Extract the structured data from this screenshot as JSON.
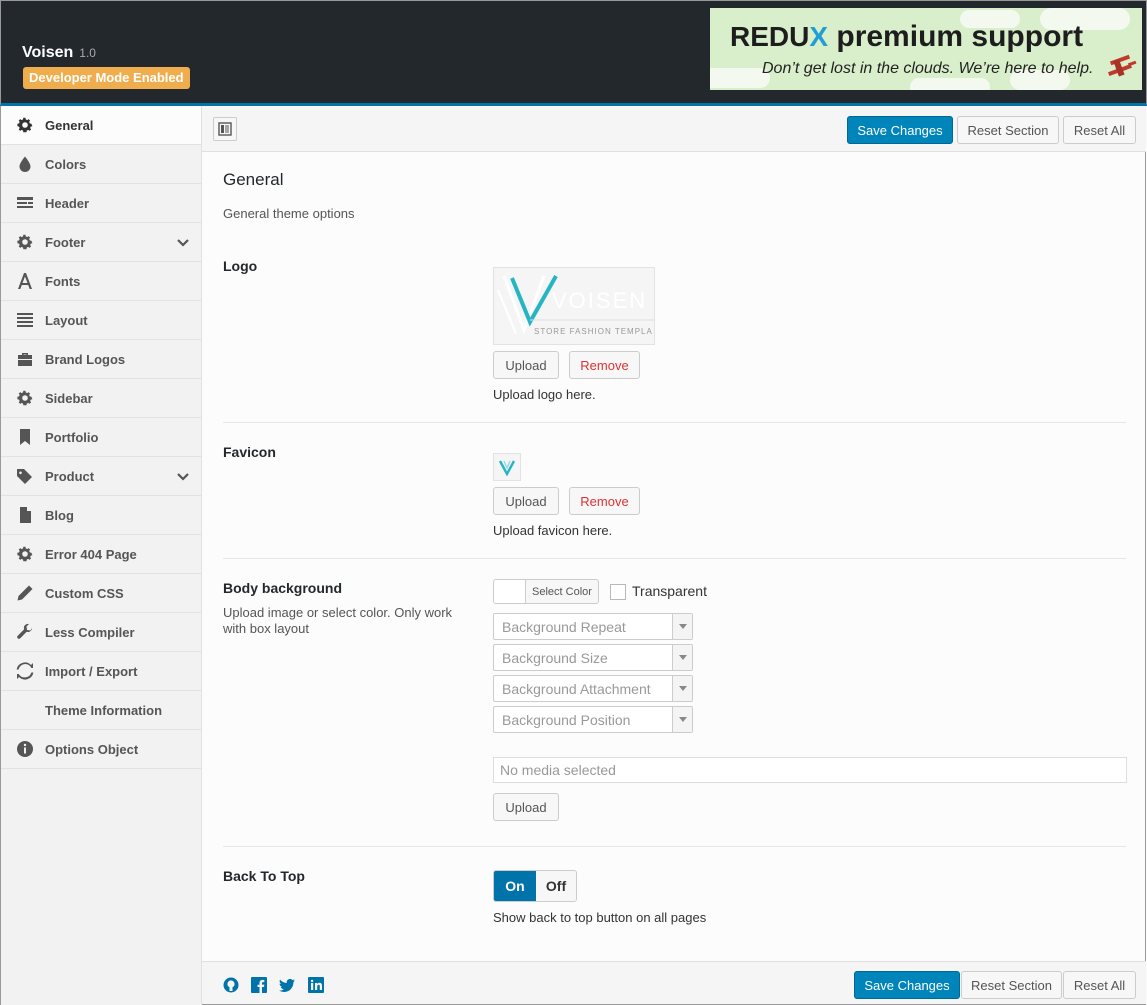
{
  "header": {
    "app_name": "Voisen",
    "version": "1.0",
    "dev_badge": "Developer Mode Enabled",
    "promo": {
      "brand": "REDU",
      "brand_x": "X",
      "headline": "premium support",
      "tagline": "Don’t get lost in the clouds. We’re here to help."
    }
  },
  "sidebar": {
    "items": [
      {
        "label": "General",
        "icon": "gear-icon"
      },
      {
        "label": "Colors",
        "icon": "drop-icon"
      },
      {
        "label": "Header",
        "icon": "header-icon"
      },
      {
        "label": "Footer",
        "icon": "gear-icon"
      },
      {
        "label": "Fonts",
        "icon": "font-icon"
      },
      {
        "label": "Layout",
        "icon": "layout-icon"
      },
      {
        "label": "Brand Logos",
        "icon": "briefcase-icon"
      },
      {
        "label": "Sidebar",
        "icon": "gear-icon"
      },
      {
        "label": "Portfolio",
        "icon": "bookmark-icon"
      },
      {
        "label": "Product",
        "icon": "tags-icon"
      },
      {
        "label": "Blog",
        "icon": "file-icon"
      },
      {
        "label": "Error 404 Page",
        "icon": "gear-icon"
      },
      {
        "label": "Custom CSS",
        "icon": "pencil-icon"
      },
      {
        "label": "Less Compiler",
        "icon": "wrench-icon"
      },
      {
        "label": "Import / Export",
        "icon": "refresh-icon"
      },
      {
        "label": "Theme Information",
        "icon": ""
      },
      {
        "label": "Options Object",
        "icon": "info-icon"
      }
    ]
  },
  "toolbar": {
    "save_label": "Save Changes",
    "reset_section_label": "Reset Section",
    "reset_all_label": "Reset All"
  },
  "section": {
    "title": "General",
    "description": "General theme options"
  },
  "fields": {
    "logo": {
      "label": "Logo",
      "preview_text": "VOISEN",
      "preview_subtext": "STORE FASHION TEMPLA",
      "upload_label": "Upload",
      "remove_label": "Remove",
      "description": "Upload logo here."
    },
    "favicon": {
      "label": "Favicon",
      "upload_label": "Upload",
      "remove_label": "Remove",
      "description": "Upload favicon here."
    },
    "body_background": {
      "label": "Body background",
      "subtitle": "Upload image or select color. Only work with box layout",
      "select_color_label": "Select Color",
      "transparent_label": "Transparent",
      "repeat_placeholder": "Background Repeat",
      "size_placeholder": "Background Size",
      "attachment_placeholder": "Background Attachment",
      "position_placeholder": "Background Position",
      "media_placeholder": "No media selected",
      "upload_label": "Upload"
    },
    "back_to_top": {
      "label": "Back To Top",
      "on_label": "On",
      "off_label": "Off",
      "value": "On",
      "description": "Show back to top button on all pages"
    }
  },
  "footer": {
    "social_icons": [
      "github-icon",
      "facebook-icon",
      "twitter-icon",
      "linkedin-icon"
    ],
    "save_label": "Save Changes",
    "reset_section_label": "Reset Section",
    "reset_all_label": "Reset All"
  },
  "colors": {
    "header_bg": "#23282d",
    "accent": "#0073aa",
    "primary_button": "#0085ba",
    "badge": "#f0ad4e",
    "remove_text": "#dc3232"
  }
}
